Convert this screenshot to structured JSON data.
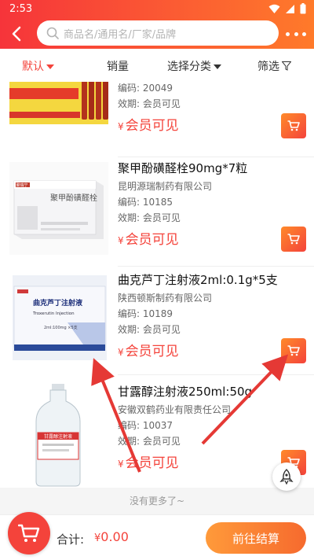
{
  "status_bar": {
    "time": "2:53"
  },
  "search": {
    "placeholder": "商品名/通用名/厂家/品牌"
  },
  "filters": [
    {
      "label": "默认"
    },
    {
      "label": "销量"
    },
    {
      "label": "选择分类"
    },
    {
      "label": "筛选"
    }
  ],
  "products": [
    {
      "code": "编码: 20049",
      "validity": "效期: 会员可见",
      "price": "会员可见",
      "yen": "¥"
    },
    {
      "name": "聚甲酚磺醛栓90mg*7粒",
      "maker": "昆明源瑞制药有限公司",
      "code": "编码: 10185",
      "validity": "效期: 会员可见",
      "price": "会员可见",
      "yen": "¥",
      "box_title": "聚甲酚磺醛栓",
      "box_brand": "聚瑞宁"
    },
    {
      "name": "曲克芦丁注射液2ml:0.1g*5支",
      "maker": "陕西顿斯制药有限公司",
      "code": "编码: 10189",
      "validity": "效期: 会员可见",
      "price": "会员可见",
      "yen": "¥",
      "box_title": "曲克芦丁注射液",
      "box_sub": "Troxerutin Injection",
      "box_spec": "2ml:100mg ×5支"
    },
    {
      "name": "甘露醇注射液250ml:50g",
      "maker": "安徽双鹤药业有限责任公司",
      "code": "编码: 10037",
      "validity": "效期: 会员可见",
      "price": "会员可见",
      "yen": "¥",
      "label_text": "甘露醇注射液"
    }
  ],
  "footer_note": "没有更多了~",
  "bottom": {
    "total_label": "合计:",
    "currency": "¥",
    "amount": "0.00",
    "checkout": "前往结算"
  },
  "colors": {
    "primary": "#f4433b",
    "accent": "#ff7a2a"
  }
}
